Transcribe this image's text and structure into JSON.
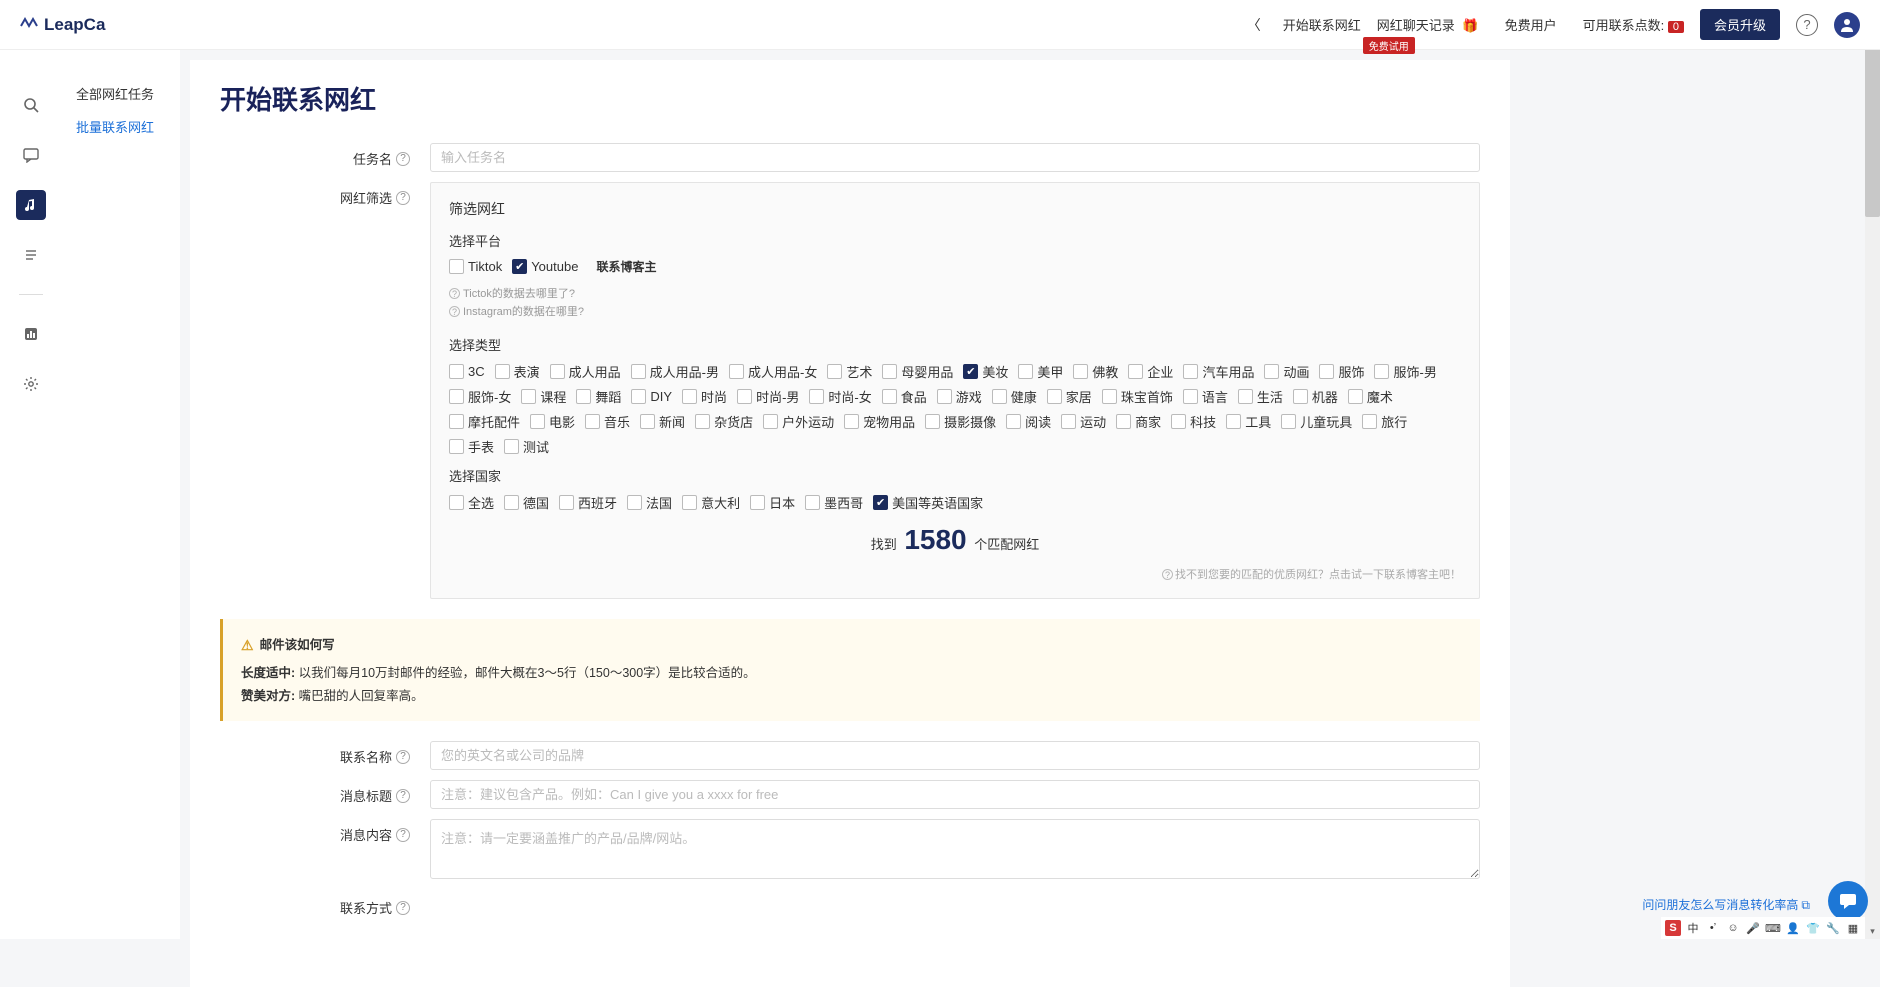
{
  "brand": "LeapCa",
  "topNav": {
    "start": "开始联系网红",
    "chatLog": "网红聊天记录",
    "freeBadge": "免费试用",
    "userType": "免费用户",
    "pointsLabel": "可用联系点数:",
    "pointsValue": "0",
    "upgrade": "会员升级"
  },
  "sidebar": {
    "allTasks": "全部网红任务",
    "batch": "批量联系网红"
  },
  "page": {
    "title": "开始联系网红"
  },
  "form": {
    "taskNameLabel": "任务名",
    "taskNamePlaceholder": "输入任务名",
    "filterLabel": "网红筛选",
    "filterTitle": "筛选网红",
    "platformLabel": "选择平台",
    "platforms": {
      "tiktok": "Tiktok",
      "youtube": "Youtube"
    },
    "contactBlogger": "联系博客主",
    "faq1": "Tictok的数据去哪里了?",
    "faq2": "Instagram的数据在哪里?",
    "typeLabel": "选择类型",
    "types": [
      "3C",
      "表演",
      "成人用品",
      "成人用品-男",
      "成人用品-女",
      "艺术",
      "母婴用品",
      "美妆",
      "美甲",
      "佛教",
      "企业",
      "汽车用品",
      "动画",
      "服饰",
      "服饰-男",
      "服饰-女",
      "课程",
      "舞蹈",
      "DIY",
      "时尚",
      "时尚-男",
      "时尚-女",
      "食品",
      "游戏",
      "健康",
      "家居",
      "珠宝首饰",
      "语言",
      "生活",
      "机器",
      "魔术",
      "摩托配件",
      "电影",
      "音乐",
      "新闻",
      "杂货店",
      "户外运动",
      "宠物用品",
      "摄影摄像",
      "阅读",
      "运动",
      "商家",
      "科技",
      "工具",
      "儿童玩具",
      "旅行",
      "手表",
      "测试"
    ],
    "typeChecked": "美妆",
    "countryLabel": "选择国家",
    "countries": [
      "全选",
      "德国",
      "西班牙",
      "法国",
      "意大利",
      "日本",
      "墨西哥",
      "美国等英语国家"
    ],
    "countryChecked": "美国等英语国家",
    "foundPrefix": "找到",
    "foundCount": "1580",
    "foundSuffix": "个匹配网红",
    "hint": "找不到您要的匹配的优质网红？点击试一下联系博客主吧！",
    "warnTitle": "邮件该如何写",
    "warnL1a": "长度适中:",
    "warnL1b": "以我们每月10万封邮件的经验，邮件大概在3～5行（150～300字）是比较合适的。",
    "warnL2a": "赞美对方:",
    "warnL2b": "嘴巴甜的人回复率高。",
    "contactNameLabel": "联系名称",
    "contactNamePlaceholder": "您的英文名或公司的品牌",
    "msgTitleLabel": "消息标题",
    "msgTitlePlaceholder": "注意：建议包含产品。例如：Can I give you a xxxx for free",
    "msgBodyLabel": "消息内容",
    "msgBodyPlaceholder": "注意：请一定要涵盖推广的产品/品牌/网站。",
    "contactMethodLabel": "联系方式"
  },
  "footer": {
    "askFriend": "问问朋友怎么写消息转化率高"
  },
  "ime": {
    "zhong": "中"
  }
}
